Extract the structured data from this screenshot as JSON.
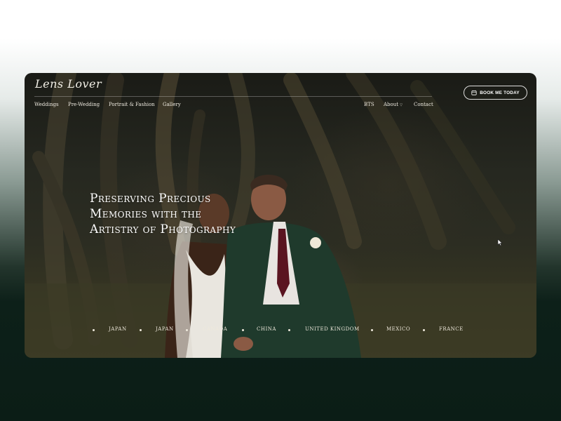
{
  "brand": {
    "logo_text": "Lens Lover"
  },
  "nav": {
    "left": [
      {
        "label": "Weddings"
      },
      {
        "label": "Pre-Wedding"
      },
      {
        "label": "Portrait & Fashion"
      },
      {
        "label": "Gallery"
      }
    ],
    "right": [
      {
        "label": "BTS"
      },
      {
        "label": "About",
        "has_dropdown": true
      },
      {
        "label": "Contact"
      }
    ]
  },
  "cta": {
    "label": "BOOK ME TODAY",
    "icon": "calendar-icon"
  },
  "hero": {
    "headline_lines": [
      "Preserving Precious",
      "Memories with the",
      "Artistry of Photography"
    ]
  },
  "countries": [
    "JAPAN",
    "JAPAN",
    "CANADA",
    "CHINA",
    "UNITED KINGDOM",
    "MEXICO",
    "FRANCE"
  ],
  "colors": {
    "page_top": "#ffffff",
    "page_bottom": "#0b1d16",
    "text_light": "#f2efe6",
    "suit_green": "#1f3a2c",
    "tie_burgundy": "#5a1420"
  }
}
